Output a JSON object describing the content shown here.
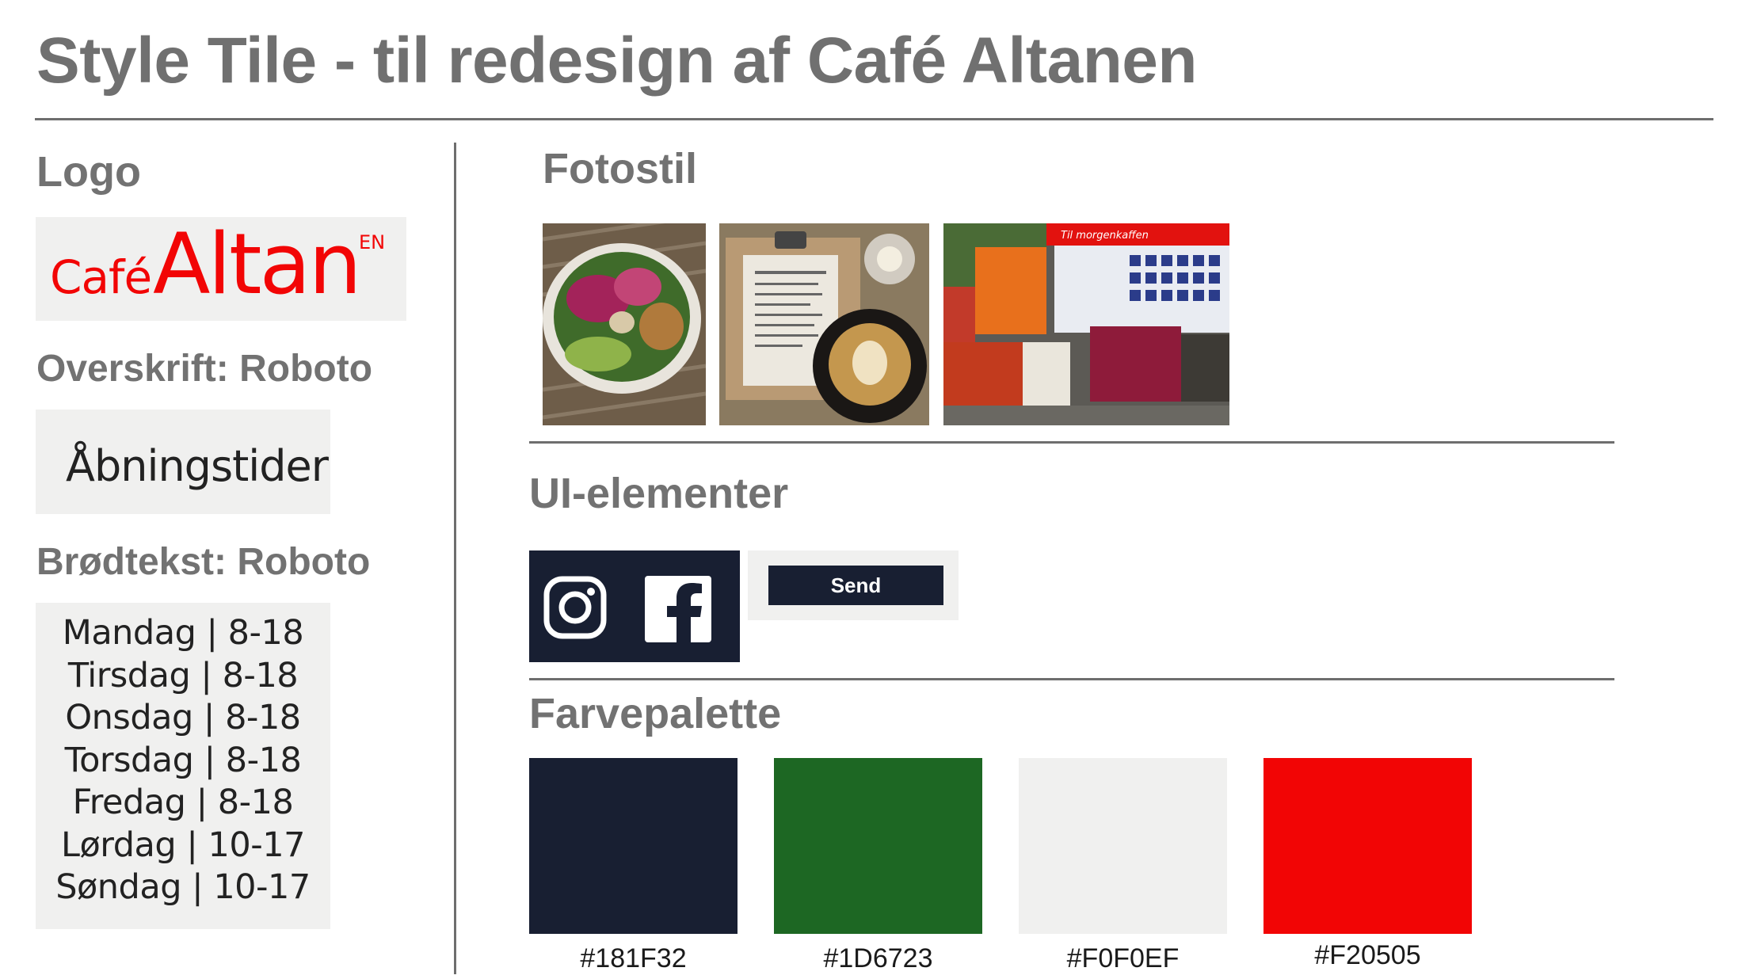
{
  "title": "Style Tile - til redesign af Café Altanen",
  "logo": {
    "heading": "Logo",
    "cafe": "Café",
    "altan": "Altan",
    "en": "EN"
  },
  "heading_font": {
    "label": "Overskrift: Roboto",
    "sample": "Åbningstider"
  },
  "body_font": {
    "label": "Brødtekst: Roboto",
    "hours": [
      "Mandag | 8-18",
      "Tirsdag | 8-18",
      "Onsdag | 8-18",
      "Torsdag | 8-18",
      "Fredag | 8-18",
      "Lørdag | 10-17",
      "Søndag | 10-17"
    ]
  },
  "photo_style": {
    "heading": "Fotostil",
    "photo3_banner": "Til morgenkaffen"
  },
  "ui_elements": {
    "heading": "UI-elementer",
    "social_icons": [
      "instagram-icon",
      "facebook-icon"
    ],
    "send_label": "Send"
  },
  "palette": {
    "heading": "Farvepalette",
    "colors": [
      {
        "hex": "#181F32",
        "value": "#181f32"
      },
      {
        "hex": "#1D6723",
        "value": "#1d6723"
      },
      {
        "hex": "#F0F0EF",
        "value": "#f0f0ef"
      },
      {
        "hex": "#F20505",
        "value": "#f20505"
      }
    ]
  }
}
